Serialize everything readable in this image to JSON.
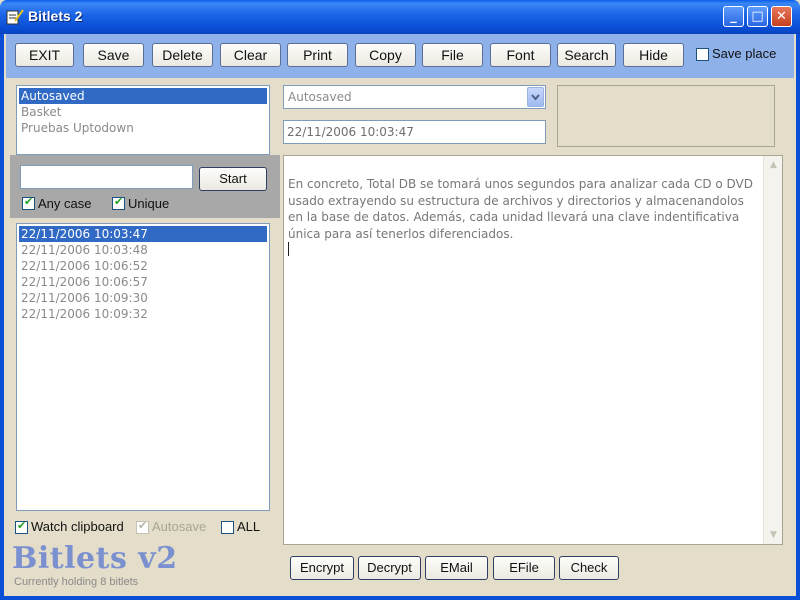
{
  "window": {
    "title": "Bitlets 2",
    "minimize": "_",
    "maximize": "□",
    "close": "✕"
  },
  "toolbar": {
    "buttons": [
      "EXIT",
      "Save",
      "Delete",
      "Clear",
      "Print",
      "Copy",
      "File",
      "Font",
      "Search",
      "Hide"
    ],
    "save_place_label": "Save place",
    "save_place_checked": false
  },
  "categories": {
    "items": [
      "Autosaved",
      "Basket",
      "Pruebas Uptodown"
    ],
    "selected": 0
  },
  "category_select": {
    "value": "Autosaved"
  },
  "timestamp_field": {
    "value": "22/11/2006 10:03:47"
  },
  "search": {
    "query": "",
    "start_label": "Start",
    "any_case_label": "Any case",
    "any_case_checked": true,
    "unique_label": "Unique",
    "unique_checked": true
  },
  "bitlets": {
    "items": [
      "22/11/2006 10:03:47",
      "22/11/2006 10:03:48",
      "22/11/2006 10:06:52",
      "22/11/2006 10:06:57",
      "22/11/2006 10:09:30",
      "22/11/2006 10:09:32"
    ],
    "selected": 0
  },
  "options": {
    "watch_clipboard_label": "Watch clipboard",
    "watch_clipboard_checked": true,
    "autosave_label": "Autosave",
    "autosave_checked": true,
    "all_label": "ALL",
    "all_checked": false
  },
  "editor": {
    "text": "En concreto, Total DB se tomará unos segundos para analizar cada CD o DVD usado extrayendo su estructura de archivos y directorios y almacenandolos en la base de datos. Además, cada unidad llevará una clave indentificativa única para así tenerlos diferenciados."
  },
  "bottom_buttons": [
    "Encrypt",
    "Decrypt",
    "EMail",
    "EFile",
    "Check"
  ],
  "footer": {
    "logo": "Bitlets v2",
    "status": "Currently holding 8 bitlets"
  },
  "colors": {
    "titlebar": "#0a4fd6",
    "toolbar": "#8fb1e9",
    "selection": "#316ac5",
    "background": "#e3ddc9"
  }
}
